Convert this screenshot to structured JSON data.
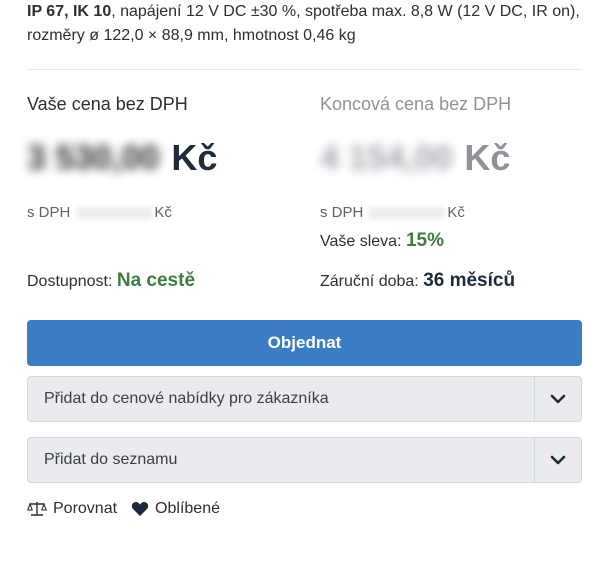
{
  "specs": {
    "ip": "IP 67",
    "sep": ", ",
    "ik": "IK 10",
    "rest": ", napájení 12 V DC ±30 %, spotřeba max. 8,8 W (12 V DC, IR on), rozměry ø 122,0 × 88,9 mm, hmotnost 0,46 kg"
  },
  "price_left": {
    "label": "Vaše cena bez DPH",
    "amount_blurred": "3 530,00",
    "currency": "Kč",
    "vat_prefix": "s DPH",
    "vat_currency": "Kč"
  },
  "price_right": {
    "label": "Koncová cena bez DPH",
    "amount_blurred": "4 154,00",
    "currency": "Kč",
    "vat_prefix": "s DPH",
    "vat_currency": "Kč"
  },
  "discount": {
    "label": "Vaše sleva:",
    "value": "15%"
  },
  "availability": {
    "label": "Dostupnost:",
    "value": "Na cestě"
  },
  "warranty": {
    "label": "Záruční doba:",
    "value": "36 měsíců"
  },
  "order_button": "Objednat",
  "quote_select": "Přidat do cenové nabídky pro zákazníka",
  "list_select": "Přidat do seznamu",
  "compare_link": "Porovnat",
  "favorite_link": "Oblíbené",
  "colors": {
    "accent": "#3a7dc4",
    "green": "#3d7d42",
    "dark": "#1d2b3a"
  },
  "icons": {
    "compare": "scales-icon",
    "favorite": "heart-icon",
    "dropdown": "chevron-down-icon"
  }
}
